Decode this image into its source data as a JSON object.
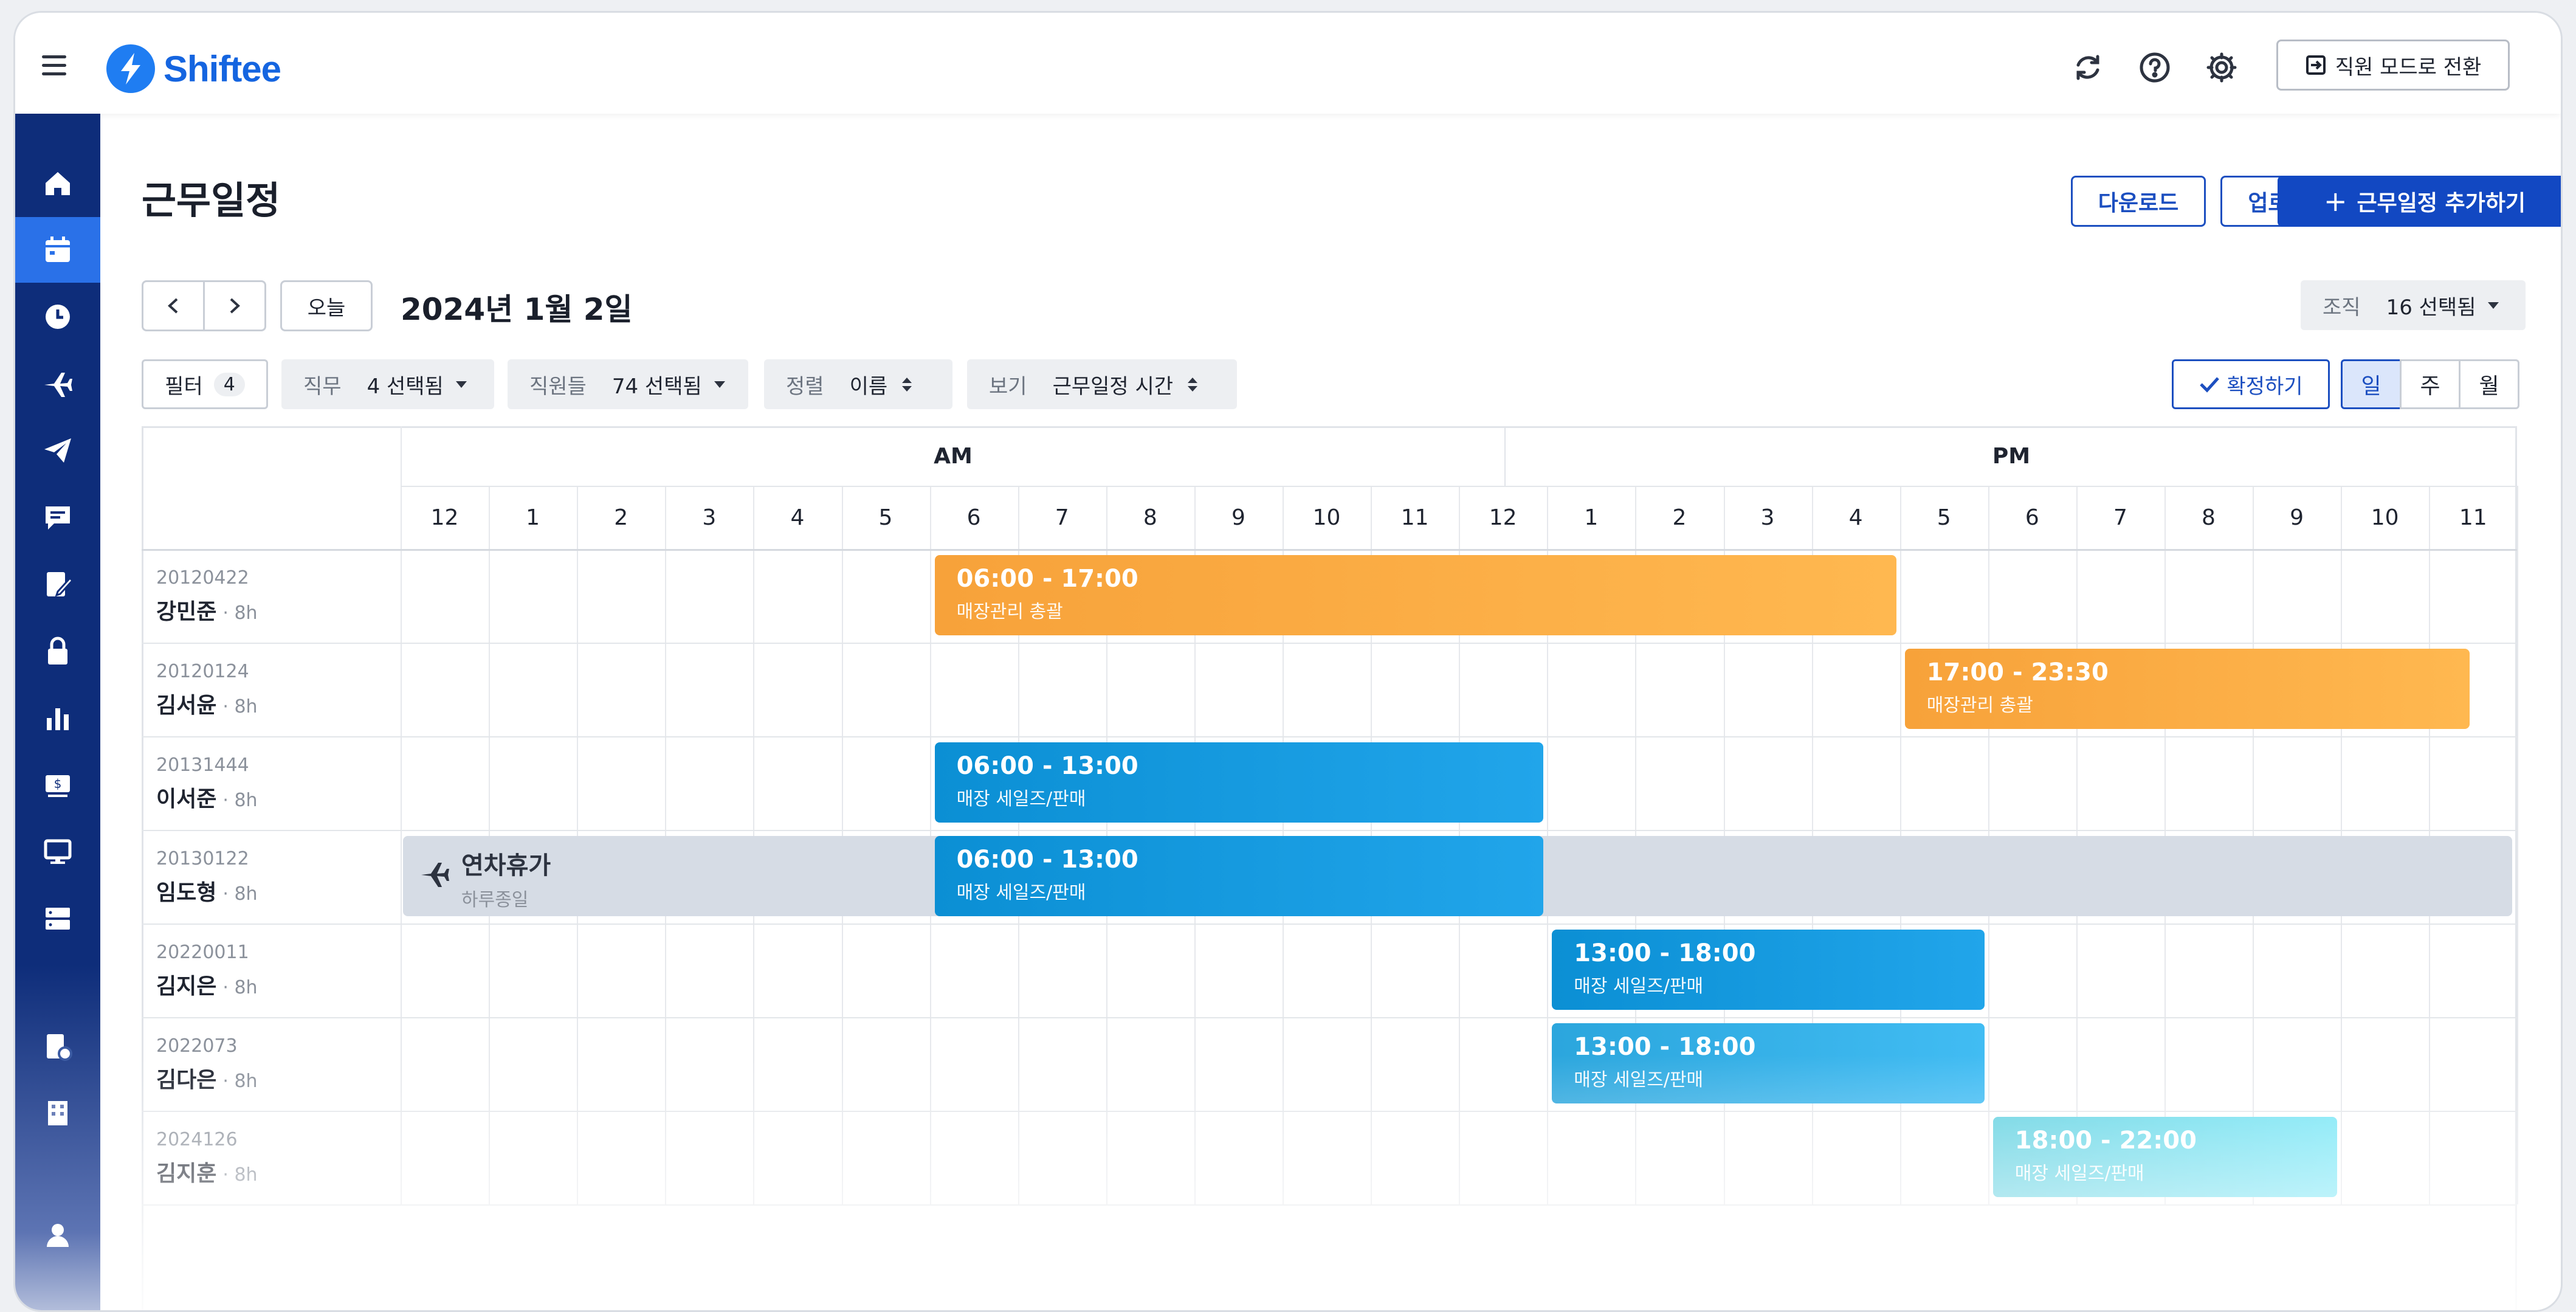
{
  "app": {
    "name": "Shiftee"
  },
  "header": {
    "employee_mode_label": "직원 모드로 전환"
  },
  "page": {
    "title": "근무일정",
    "download_label": "다운로드",
    "upload_label": "업로드",
    "add_label": "근무일정 추가하기",
    "today_label": "오늘",
    "date_title": "2024년 1월 2일",
    "org_key": "조직",
    "org_value": "16 선택됨"
  },
  "filters": {
    "filter_label": "필터",
    "filter_count": "4",
    "job_key": "직무",
    "job_value": "4 선택됨",
    "staff_key": "직원들",
    "staff_value": "74 선택됨",
    "sort_key": "정렬",
    "sort_value": "이름",
    "view_key": "보기",
    "view_value": "근무일정 시간",
    "confirm_label": "확정하기",
    "view_modes": [
      "일",
      "주",
      "월"
    ]
  },
  "timeline": {
    "am_label": "AM",
    "pm_label": "PM",
    "hours": [
      "12",
      "1",
      "2",
      "3",
      "4",
      "5",
      "6",
      "7",
      "8",
      "9",
      "10",
      "11",
      "12",
      "1",
      "2",
      "3",
      "4",
      "5",
      "6",
      "7",
      "8",
      "9",
      "10",
      "11"
    ]
  },
  "rows": [
    {
      "id": "20120422",
      "name": "강민준",
      "hours": "· 8h"
    },
    {
      "id": "20120124",
      "name": "김서윤",
      "hours": "· 8h"
    },
    {
      "id": "20131444",
      "name": "이서준",
      "hours": "· 8h"
    },
    {
      "id": "20130122",
      "name": "임도형",
      "hours": "· 8h"
    },
    {
      "id": "20220011",
      "name": "김지은",
      "hours": "· 8h"
    },
    {
      "id": "2022073",
      "name": "김다은",
      "hours": "· 8h"
    },
    {
      "id": "2024126",
      "name": "김지훈",
      "hours": "· 8h"
    }
  ],
  "shifts": [
    {
      "row": 0,
      "start": 6,
      "end": 17,
      "time": "06:00 - 17:00",
      "role": "매장관리 총괄",
      "color": "#f7a23a"
    },
    {
      "row": 1,
      "start": 17,
      "end": 23.5,
      "time": "17:00 - 23:30",
      "role": "매장관리 총괄",
      "color": "#f7a23a"
    },
    {
      "row": 2,
      "start": 6,
      "end": 13,
      "time": "06:00 - 13:00",
      "role": "매장 세일즈/판매",
      "color": "#0b8fd4"
    },
    {
      "row": 3,
      "start": 6,
      "end": 13,
      "time": "06:00 - 13:00",
      "role": "매장 세일즈/판매",
      "color": "#0b8fd4"
    },
    {
      "row": 4,
      "start": 13,
      "end": 18,
      "time": "13:00 - 18:00",
      "role": "매장 세일즈/판매",
      "color": "#0b8fd4"
    },
    {
      "row": 5,
      "start": 13,
      "end": 18,
      "time": "13:00 - 18:00",
      "role": "매장 세일즈/판매",
      "color": "#2ba6dd"
    },
    {
      "row": 6,
      "start": 18,
      "end": 22,
      "time": "18:00 - 22:00",
      "role": "매장 세일즈/판매",
      "color": "#5fd0e0"
    }
  ],
  "leave": {
    "row": 3,
    "title": "연차휴가",
    "subtitle": "하루종일",
    "color": "#d6dce5"
  }
}
